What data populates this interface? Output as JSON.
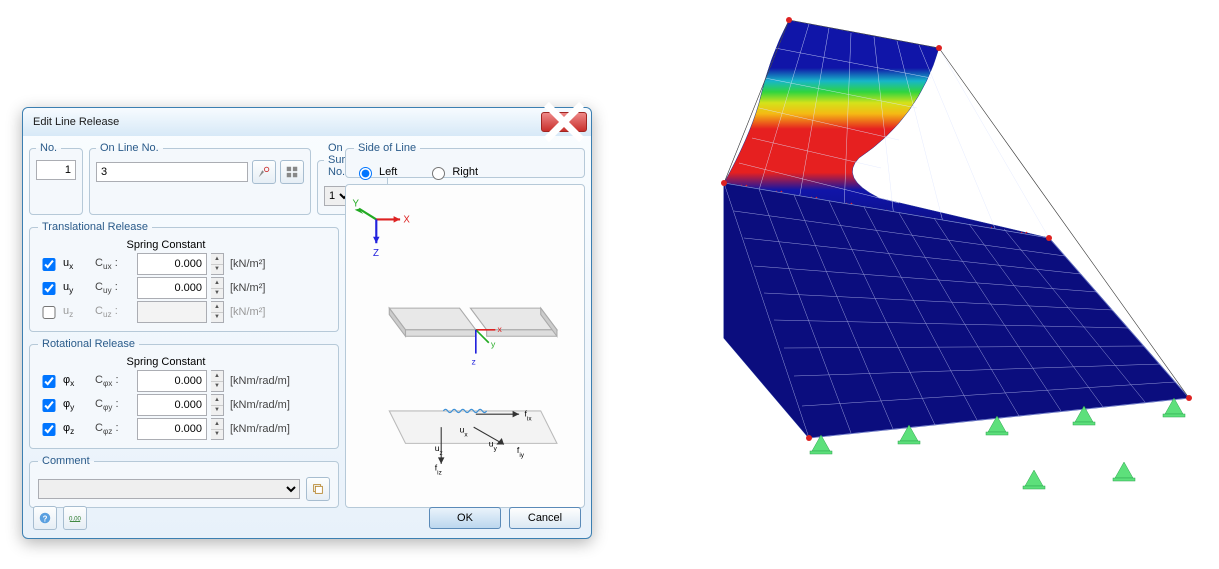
{
  "dialog": {
    "title": "Edit Line Release",
    "no_label": "No.",
    "no_value": "1",
    "online_label": "On Line No.",
    "online_value": "3",
    "onsurface_label": "On Surface No.",
    "onsurface_value": "1",
    "side_label": "Side of Line",
    "side_left": "Left",
    "side_right": "Right",
    "translational_label": "Translational Release",
    "rotational_label": "Rotational Release",
    "spring_header": "Spring Constant",
    "trans": [
      {
        "checked": true,
        "axis": "ux",
        "const": "Cux",
        "value": "0.000",
        "unit": "[kN/m²]"
      },
      {
        "checked": true,
        "axis": "uy",
        "const": "Cuy",
        "value": "0.000",
        "unit": "[kN/m²]"
      },
      {
        "checked": false,
        "axis": "uz",
        "const": "Cuz",
        "value": "",
        "unit": "[kN/m²]"
      }
    ],
    "rot": [
      {
        "checked": true,
        "axis": "φx",
        "const": "Cφx",
        "value": "0.000",
        "unit": "[kNm/rad/m]"
      },
      {
        "checked": true,
        "axis": "φy",
        "const": "Cφy",
        "value": "0.000",
        "unit": "[kNm/rad/m]"
      },
      {
        "checked": true,
        "axis": "φz",
        "const": "Cφz",
        "value": "0.000",
        "unit": "[kNm/rad/m]"
      }
    ],
    "comment_label": "Comment",
    "comment_value": "",
    "ok": "OK",
    "cancel": "Cancel"
  }
}
